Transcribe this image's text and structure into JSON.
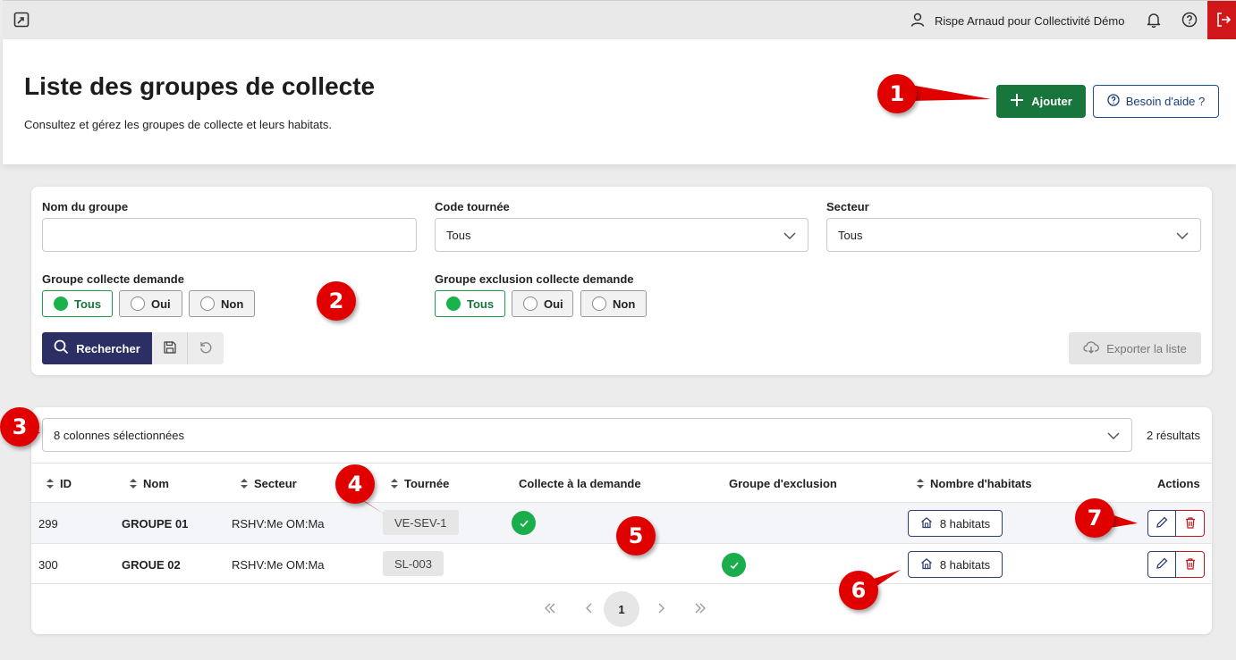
{
  "topbar": {
    "user_label": "Rispe Arnaud pour Collectivité Démo",
    "icons": [
      "expand-icon",
      "user-icon",
      "bell-icon",
      "help-icon",
      "logout-icon"
    ]
  },
  "header": {
    "title": "Liste des groupes de collecte",
    "subtitle": "Consultez et gérez les groupes de collecte et leurs habitats.",
    "add_label": "Ajouter",
    "help_label": "Besoin d'aide ?"
  },
  "filters": {
    "nom_label": "Nom du groupe",
    "nom_value": "",
    "code_label": "Code tournée",
    "code_value": "Tous",
    "secteur_label": "Secteur",
    "secteur_value": "Tous",
    "demande_label": "Groupe collecte demande",
    "demande_options": [
      "Tous",
      "Oui",
      "Non"
    ],
    "exclusion_label": "Groupe exclusion collecte demande",
    "exclusion_options": [
      "Tous",
      "Oui",
      "Non"
    ],
    "search_label": "Rechercher",
    "export_label": "Exporter la liste"
  },
  "results": {
    "columns_select": "8 colonnes sélectionnées",
    "count": "2 résultats",
    "headers": [
      "ID",
      "Nom",
      "Secteur",
      "Tournée",
      "Collecte à la demande",
      "Groupe d'exclusion",
      "Nombre d'habitats",
      "Actions"
    ],
    "rows": [
      {
        "id": "299",
        "nom": "GROUPE 01",
        "secteur": "RSHV:Me OM:Ma",
        "tournee": "VE-SEV-1",
        "collecte_demande": true,
        "groupe_exclusion": false,
        "habitats": "8 habitats"
      },
      {
        "id": "300",
        "nom": "GROUE 02",
        "secteur": "RSHV:Me OM:Ma",
        "tournee": "SL-003",
        "collecte_demande": false,
        "groupe_exclusion": true,
        "habitats": "8 habitats"
      }
    ],
    "current_page": "1"
  },
  "annotations": [
    "1",
    "2",
    "3",
    "4",
    "5",
    "6",
    "7"
  ],
  "colors": {
    "primary_green": "#18753c",
    "navy": "#2b2f63",
    "danger": "#d0181b",
    "check_green": "#1aad4b",
    "annotation_red": "#e00000"
  }
}
